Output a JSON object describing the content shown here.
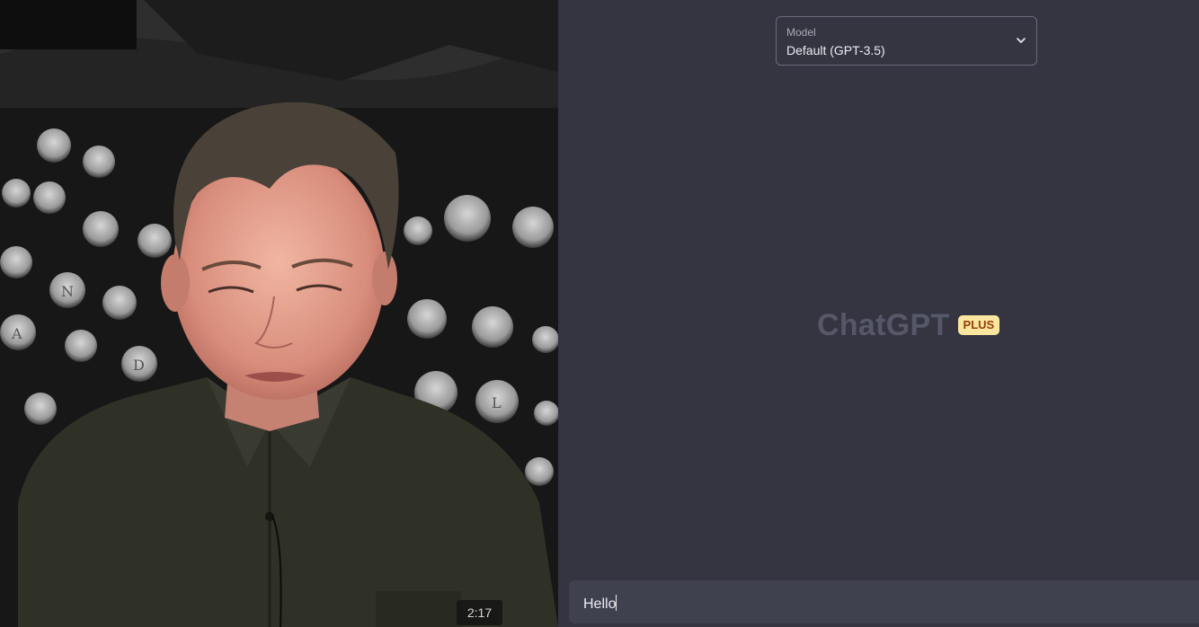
{
  "video": {
    "timestamp": "2:17",
    "typewriter_key_letters": [
      "N",
      "A",
      "D",
      "L"
    ]
  },
  "chat": {
    "model_selector": {
      "label": "Model",
      "value": "Default (GPT-3.5)"
    },
    "brand": {
      "name": "ChatGPT",
      "badge": "PLUS"
    },
    "input": {
      "value": "Hello"
    }
  },
  "colors": {
    "panel_background": "#343541",
    "input_background": "#40414f",
    "badge_background": "#fae69e",
    "badge_text": "#92400e",
    "brand_text": "#565869"
  },
  "icons": {
    "model_dropdown": "chevron-down-icon"
  }
}
